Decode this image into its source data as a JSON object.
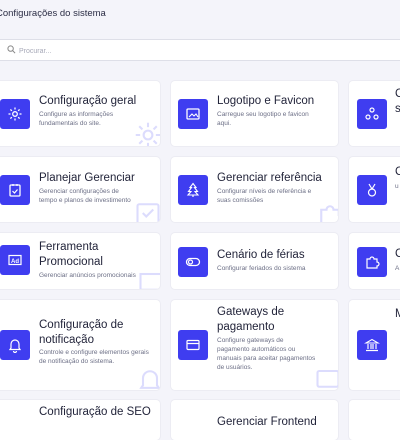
{
  "page": {
    "title": "Configurações do sistema"
  },
  "search": {
    "placeholder": "Procurar..."
  },
  "cards": [
    {
      "title": "Configuração geral",
      "desc": "Configure as informações fundamentais do site.",
      "icon": "gear-icon"
    },
    {
      "title": "Logotipo e Favicon",
      "desc": "Carregue seu logotipo e favicon aqui.",
      "icon": "image-icon"
    },
    {
      "title": "",
      "desc": "",
      "icon": "network-icon",
      "title_frag": "C",
      "title_frag2": "s"
    },
    {
      "title": "Planejar Gerenciar",
      "desc": "Gerenciar configurações de tempo e planos de investimento",
      "icon": "calendar-check-icon"
    },
    {
      "title": "Gerenciar referência",
      "desc": "Configurar níveis de referência e suas comissões",
      "icon": "tree-icon"
    },
    {
      "title": "",
      "desc": "",
      "icon": "medal-icon",
      "title_frag": "C",
      "desc_frag": "u"
    },
    {
      "title": "Ferramenta Promocional",
      "desc": "Gerenciar anúncios promocionais",
      "icon": "ad-icon"
    },
    {
      "title": "Cenário de férias",
      "desc": "Configurar feriados do sistema",
      "icon": "toggle-icon"
    },
    {
      "title": "",
      "desc": "",
      "icon": "puzzle-icon",
      "title_frag": "C",
      "desc_frag": "A"
    },
    {
      "title": "Configuração de notificação",
      "desc": "Controle e configure elementos gerais de notificação do sistema.",
      "icon": "bell-icon"
    },
    {
      "title": "Gateways de pagamento",
      "desc": "Configure gateways de pagamento automáticos ou manuais para aceitar pagamentos de usuários.",
      "icon": "credit-card-icon"
    },
    {
      "title": "",
      "desc": "",
      "icon": "bank-icon",
      "title_frag": "M"
    },
    {
      "title": "Configuração de SEO",
      "desc": "",
      "icon": "seo-icon"
    },
    {
      "title": "Gerenciar Frontend",
      "desc": "",
      "icon": "layout-icon"
    }
  ],
  "colors": {
    "accent": "#3f3df0",
    "background": "#f4f4fa",
    "card": "#ffffff"
  }
}
